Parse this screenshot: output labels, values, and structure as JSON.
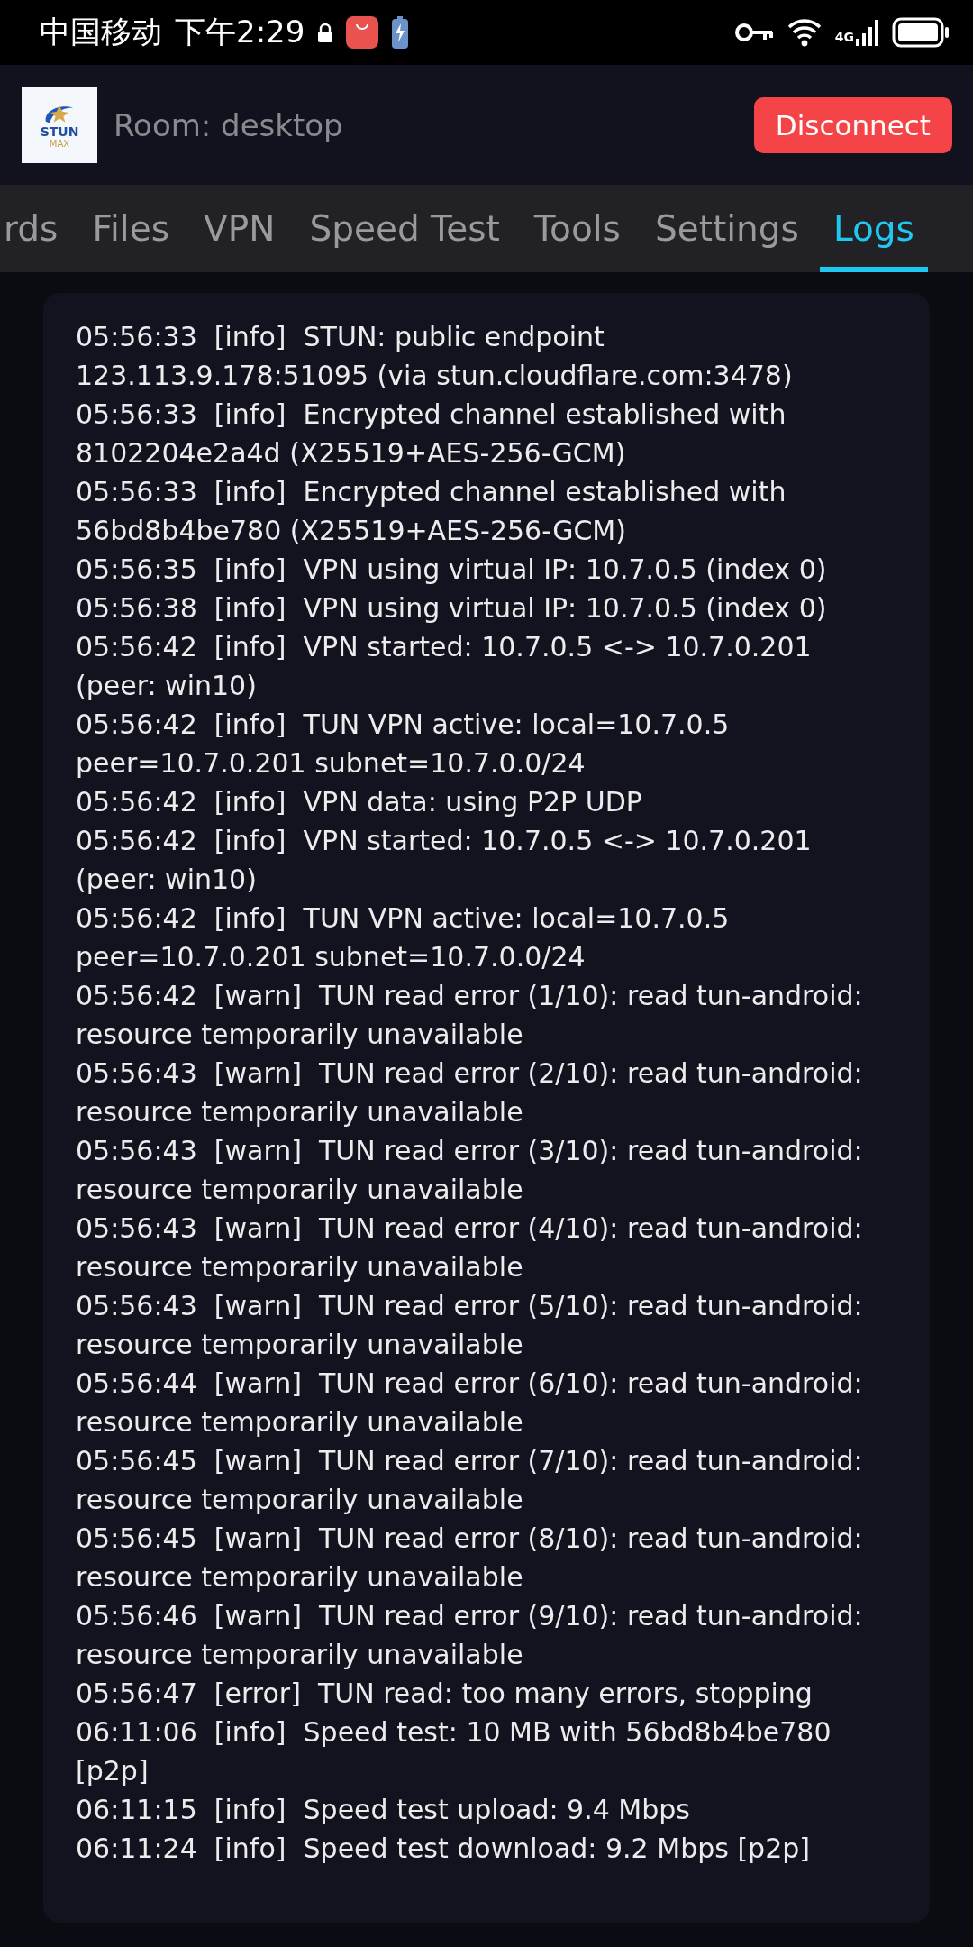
{
  "status_bar": {
    "carrier": "中国移动",
    "time": "下午2:29",
    "network": "4G"
  },
  "header": {
    "logo": {
      "line_1": "STUN",
      "line_2": "MAX"
    },
    "room": "Room: desktop",
    "disconnect_button": "Disconnect"
  },
  "tabs": [
    {
      "label": "rds",
      "selected": false
    },
    {
      "label": "Files",
      "selected": false
    },
    {
      "label": "VPN",
      "selected": false
    },
    {
      "label": "Speed Test",
      "selected": false
    },
    {
      "label": "Tools",
      "selected": false
    },
    {
      "label": "Settings",
      "selected": false
    },
    {
      "label": "Logs",
      "selected": true
    }
  ],
  "logs": [
    {
      "time": "05:56:33",
      "level": "[info]",
      "message": "STUN: public endpoint 123.113.9.178:51095 (via stun.cloudflare.com:3478)"
    },
    {
      "time": "05:56:33",
      "level": "[info]",
      "message": "Encrypted channel established with 8102204e2a4d (X25519+AES-256-GCM)"
    },
    {
      "time": "05:56:33",
      "level": "[info]",
      "message": "Encrypted channel established with 56bd8b4be780 (X25519+AES-256-GCM)"
    },
    {
      "time": "05:56:35",
      "level": "[info]",
      "message": "VPN using virtual IP: 10.7.0.5 (index 0)"
    },
    {
      "time": "05:56:38",
      "level": "[info]",
      "message": "VPN using virtual IP: 10.7.0.5 (index 0)"
    },
    {
      "time": "05:56:42",
      "level": "[info]",
      "message": "VPN started: 10.7.0.5 <-> 10.7.0.201 (peer: win10)"
    },
    {
      "time": "05:56:42",
      "level": "[info]",
      "message": "TUN VPN active: local=10.7.0.5 peer=10.7.0.201 subnet=10.7.0.0/24"
    },
    {
      "time": "05:56:42",
      "level": "[info]",
      "message": "VPN data: using P2P UDP"
    },
    {
      "time": "05:56:42",
      "level": "[info]",
      "message": "VPN started: 10.7.0.5 <-> 10.7.0.201 (peer: win10)"
    },
    {
      "time": "05:56:42",
      "level": "[info]",
      "message": "TUN VPN active: local=10.7.0.5 peer=10.7.0.201 subnet=10.7.0.0/24"
    },
    {
      "time": "05:56:42",
      "level": "[warn]",
      "message": "TUN read error (1/10): read tun-android: resource temporarily unavailable"
    },
    {
      "time": "05:56:43",
      "level": "[warn]",
      "message": "TUN read error (2/10): read tun-android: resource temporarily unavailable"
    },
    {
      "time": "05:56:43",
      "level": "[warn]",
      "message": "TUN read error (3/10): read tun-android: resource temporarily unavailable"
    },
    {
      "time": "05:56:43",
      "level": "[warn]",
      "message": "TUN read error (4/10): read tun-android: resource temporarily unavailable"
    },
    {
      "time": "05:56:43",
      "level": "[warn]",
      "message": "TUN read error (5/10): read tun-android: resource temporarily unavailable"
    },
    {
      "time": "05:56:44",
      "level": "[warn]",
      "message": "TUN read error (6/10): read tun-android: resource temporarily unavailable"
    },
    {
      "time": "05:56:45",
      "level": "[warn]",
      "message": "TUN read error (7/10): read tun-android: resource temporarily unavailable"
    },
    {
      "time": "05:56:45",
      "level": "[warn]",
      "message": "TUN read error (8/10): read tun-android: resource temporarily unavailable"
    },
    {
      "time": "05:56:46",
      "level": "[warn]",
      "message": "TUN read error (9/10): read tun-android: resource temporarily unavailable"
    },
    {
      "time": "05:56:47",
      "level": "[error]",
      "message": "TUN read: too many errors, stopping"
    },
    {
      "time": "06:11:06",
      "level": "[info]",
      "message": "Speed test: 10 MB with 56bd8b4be780 [p2p]"
    },
    {
      "time": "06:11:15",
      "level": "[info]",
      "message": "Speed test upload: 9.4 Mbps"
    },
    {
      "time": "06:11:24",
      "level": "[info]",
      "message": "Speed test download: 9.2 Mbps [p2p]"
    }
  ]
}
